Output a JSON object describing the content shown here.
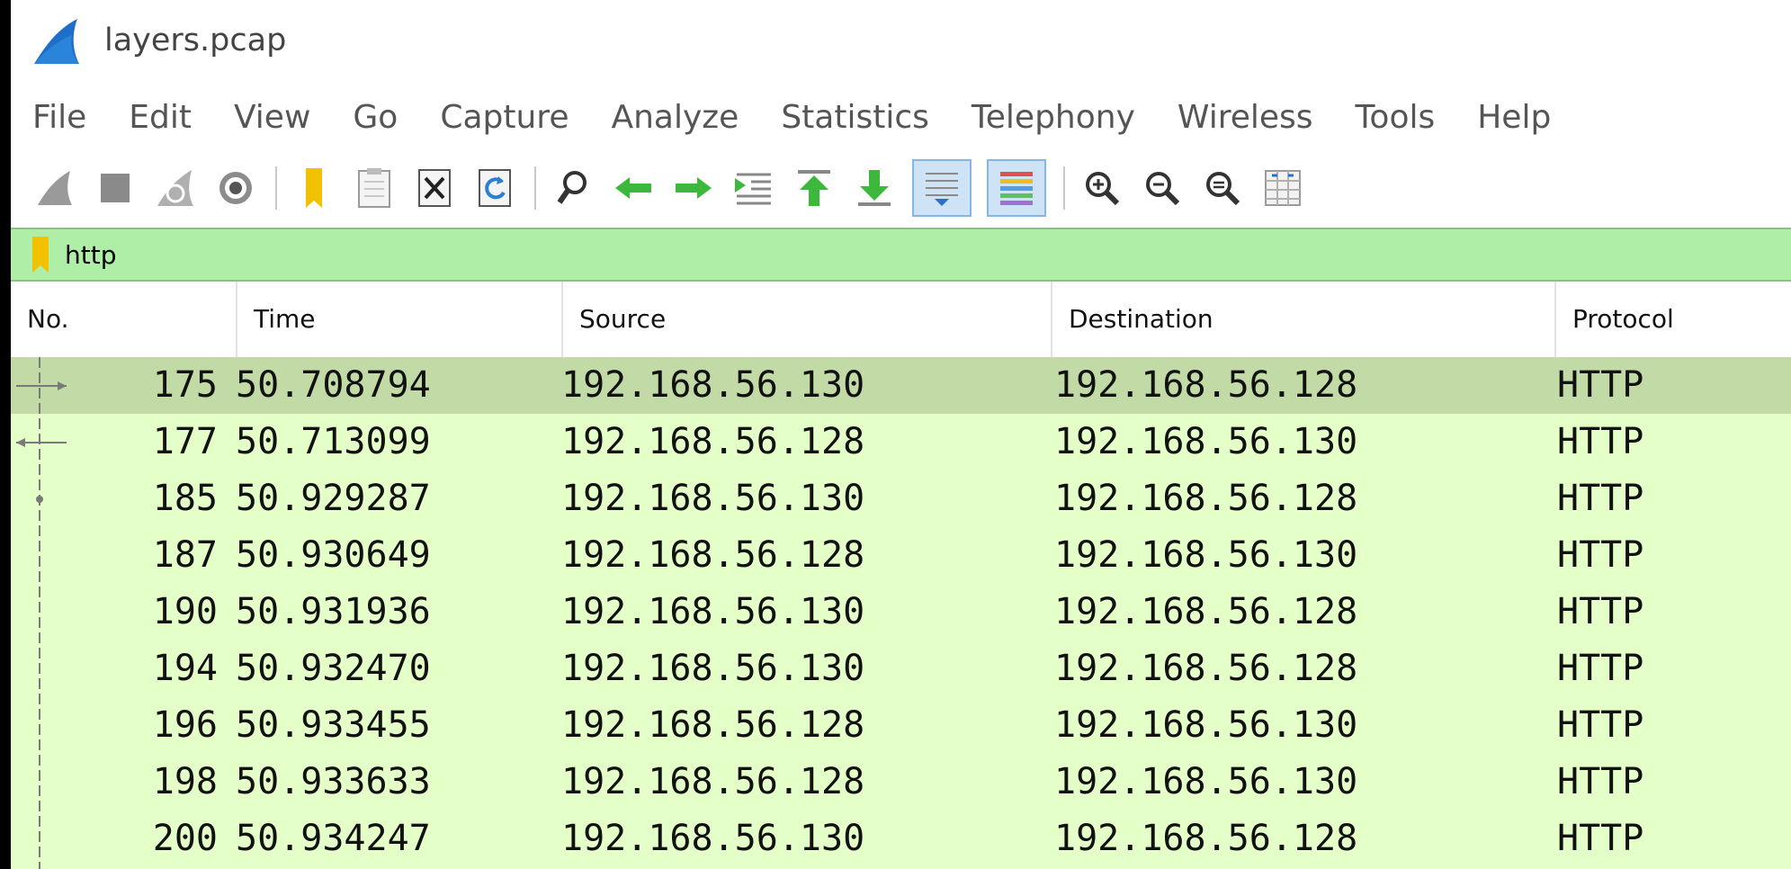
{
  "window": {
    "title": "layers.pcap"
  },
  "menu": [
    "File",
    "Edit",
    "View",
    "Go",
    "Capture",
    "Analyze",
    "Statistics",
    "Telephony",
    "Wireless",
    "Tools",
    "Help"
  ],
  "toolbar": {
    "icons": [
      "shark-fin-start-icon",
      "stop-square-icon",
      "restart-capture-icon",
      "capture-options-gear-icon",
      "open-file-icon",
      "file-set-icon",
      "close-file-icon",
      "reload-file-icon",
      "find-packet-icon",
      "go-back-icon",
      "go-forward-icon",
      "go-to-packet-icon",
      "go-first-packet-icon",
      "go-last-packet-icon",
      "autoscroll-icon",
      "colorize-icon",
      "zoom-in-icon",
      "zoom-out-icon",
      "normal-size-icon",
      "resize-columns-icon"
    ]
  },
  "filter": {
    "value": "http",
    "bg_color": "#aeeea6"
  },
  "packet_list": {
    "columns": [
      "No.",
      "Time",
      "Source",
      "Destination",
      "Protocol"
    ],
    "rows": [
      {
        "no": "175",
        "time": "50.708794",
        "source": "192.168.56.130",
        "destination": "192.168.56.128",
        "protocol": "HTTP",
        "selected": true
      },
      {
        "no": "177",
        "time": "50.713099",
        "source": "192.168.56.128",
        "destination": "192.168.56.130",
        "protocol": "HTTP"
      },
      {
        "no": "185",
        "time": "50.929287",
        "source": "192.168.56.130",
        "destination": "192.168.56.128",
        "protocol": "HTTP"
      },
      {
        "no": "187",
        "time": "50.930649",
        "source": "192.168.56.128",
        "destination": "192.168.56.130",
        "protocol": "HTTP"
      },
      {
        "no": "190",
        "time": "50.931936",
        "source": "192.168.56.130",
        "destination": "192.168.56.128",
        "protocol": "HTTP"
      },
      {
        "no": "194",
        "time": "50.932470",
        "source": "192.168.56.130",
        "destination": "192.168.56.128",
        "protocol": "HTTP"
      },
      {
        "no": "196",
        "time": "50.933455",
        "source": "192.168.56.128",
        "destination": "192.168.56.130",
        "protocol": "HTTP"
      },
      {
        "no": "198",
        "time": "50.933633",
        "source": "192.168.56.128",
        "destination": "192.168.56.130",
        "protocol": "HTTP"
      },
      {
        "no": "200",
        "time": "50.934247",
        "source": "192.168.56.130",
        "destination": "192.168.56.128",
        "protocol": "HTTP"
      }
    ],
    "row_color": "#e4ffc7",
    "selected_color": "#c2dba6"
  }
}
